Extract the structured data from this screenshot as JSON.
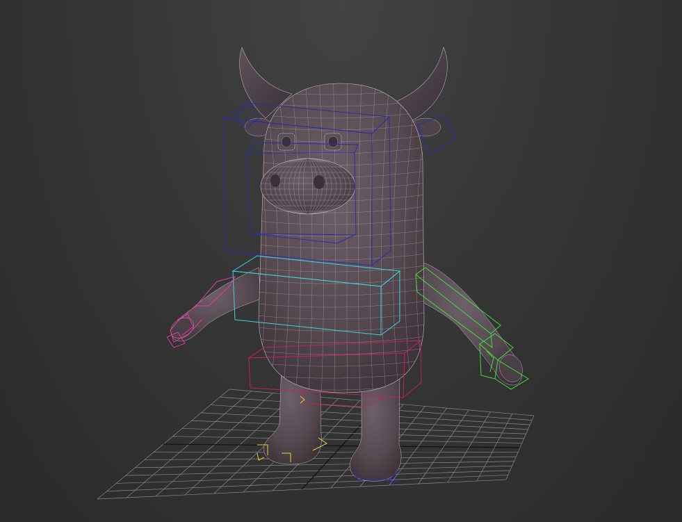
{
  "viewport": {
    "name": "perspective-viewport",
    "background": "#363636"
  },
  "colors": {
    "grid": "#8a8a8a",
    "grid_axis": "#111111",
    "mesh_fill": "#5b4f58",
    "mesh_fill_dark": "#3a3038",
    "wire": "#c8bcc6",
    "head_bones": "#2b2ea8",
    "spine_bones": "#38d6dc",
    "right_arm_bones": "#e23aa4",
    "left_arm_bones": "#3ee03a",
    "pelvis_bones": "#c0245e",
    "foot_left_bones": "#e6d23a",
    "foot_right_bones": "#2a2ad0"
  },
  "scene": {
    "object": "cow-character-mesh",
    "rig": "biped-rig",
    "grid": "home-grid"
  }
}
